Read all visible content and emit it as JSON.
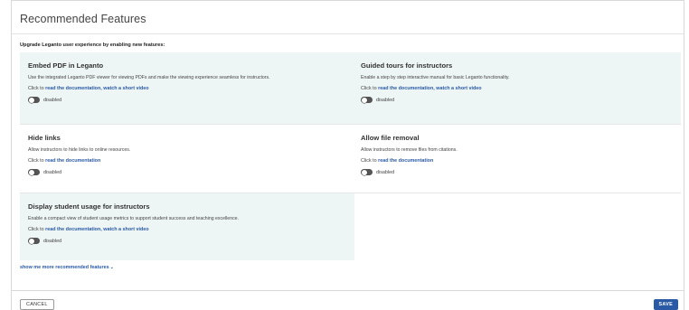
{
  "dialog": {
    "title": "Recommended Features",
    "intro": "Upgrade Leganto user experience by enabling new features:"
  },
  "features": [
    {
      "title": "Embed PDF in Leganto",
      "description": "Use the integrated Leganto PDF viewer for viewing PDFs and make the viewing experience seamless for instructors.",
      "click_prefix": "Click to ",
      "link_text": "read the documentation, watch a short video",
      "status": "disabled",
      "enabled": false
    },
    {
      "title": "Guided tours for instructors",
      "description": "Enable a step by step interactive manual for basic Leganto functionality.",
      "click_prefix": "Click to ",
      "link_text": "read the documentation, watch a short video",
      "status": "disabled",
      "enabled": false
    },
    {
      "title": "Hide links",
      "description": "Allow instructors to hide links to online resources.",
      "click_prefix": "Click to ",
      "link_text": "read the documentation",
      "status": "disabled",
      "enabled": false
    },
    {
      "title": "Allow file removal",
      "description": "Allow instructors to remove files from citations.",
      "click_prefix": "Click to ",
      "link_text": "read the documentation",
      "status": "disabled",
      "enabled": false
    },
    {
      "title": "Display student usage for instructors",
      "description": "Enable a compact view of student usage metrics to support student success and teaching excellence.",
      "click_prefix": "Click to ",
      "link_text": "read the documentation, watch a short video",
      "status": "disabled",
      "enabled": false
    }
  ],
  "more_link": {
    "label": "show me more recommended features",
    "icon": "chevron-down-icon"
  },
  "footer": {
    "cancel_label": "CANCEL",
    "save_label": "SAVE"
  },
  "colors": {
    "accent": "#2a5aa5",
    "card_shade": "#eef5f5",
    "toggle_off": "#555555"
  }
}
